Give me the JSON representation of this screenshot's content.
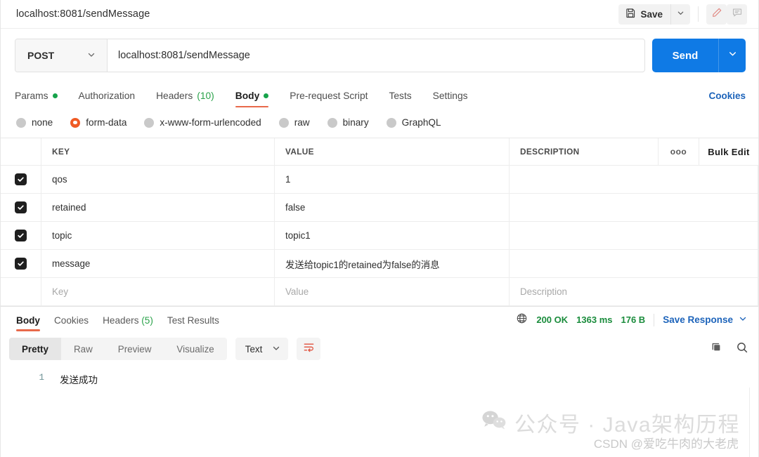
{
  "window": {
    "tab_title": "localhost:8081/sendMessage"
  },
  "toolbar": {
    "save_label": "Save",
    "save_icon": "floppy-disk-icon",
    "save_caret_icon": "chevron-down-icon",
    "edit_icon": "pencil-icon",
    "comment_icon": "comment-icon"
  },
  "request": {
    "method": "POST",
    "method_caret_icon": "chevron-down-icon",
    "url": "localhost:8081/sendMessage",
    "url_placeholder": "Enter request URL",
    "send_label": "Send",
    "send_caret_icon": "chevron-down-icon",
    "accent_blue": "#0f7ae5"
  },
  "request_tabs": {
    "items": [
      {
        "label": "Params",
        "dot": true,
        "count": "",
        "active": false
      },
      {
        "label": "Authorization",
        "dot": false,
        "count": "",
        "active": false
      },
      {
        "label": "Headers",
        "dot": false,
        "count": "(10)",
        "active": false
      },
      {
        "label": "Body",
        "dot": true,
        "count": "",
        "active": true
      },
      {
        "label": "Pre-request Script",
        "dot": false,
        "count": "",
        "active": false
      },
      {
        "label": "Tests",
        "dot": false,
        "count": "",
        "active": false
      },
      {
        "label": "Settings",
        "dot": false,
        "count": "",
        "active": false
      }
    ],
    "cookies_label": "Cookies",
    "active_underline_color": "#e8694a",
    "dot_color": "#16a34a"
  },
  "body_types": {
    "options": [
      {
        "label": "none",
        "selected": false
      },
      {
        "label": "form-data",
        "selected": true
      },
      {
        "label": "x-www-form-urlencoded",
        "selected": false
      },
      {
        "label": "raw",
        "selected": false
      },
      {
        "label": "binary",
        "selected": false
      },
      {
        "label": "GraphQL",
        "selected": false
      }
    ],
    "selected_color": "#ef5b25"
  },
  "kv_table": {
    "headers": {
      "key": "KEY",
      "value": "VALUE",
      "description": "DESCRIPTION",
      "more_icon": "ellipsis-icon",
      "more_glyph": "ooo",
      "bulk_edit": "Bulk Edit"
    },
    "rows": [
      {
        "checked": true,
        "key": "qos",
        "value": "1",
        "description": ""
      },
      {
        "checked": true,
        "key": "retained",
        "value": "false",
        "description": ""
      },
      {
        "checked": true,
        "key": "topic",
        "value": "topic1",
        "description": ""
      },
      {
        "checked": true,
        "key": "message",
        "value": "发送给topic1的retained为false的消息",
        "description": ""
      }
    ],
    "empty_row": {
      "key_placeholder": "Key",
      "value_placeholder": "Value",
      "description_placeholder": "Description"
    }
  },
  "response": {
    "tabs": [
      {
        "label": "Body",
        "count": "",
        "active": true
      },
      {
        "label": "Cookies",
        "count": "",
        "active": false
      },
      {
        "label": "Headers",
        "count": "(5)",
        "active": false
      },
      {
        "label": "Test Results",
        "count": "",
        "active": false
      }
    ],
    "globe_icon": "globe-icon",
    "status": "200 OK",
    "time": "1363 ms",
    "size": "176 B",
    "save_response": "Save Response",
    "save_response_caret_icon": "chevron-down-icon",
    "status_color": "#1a8c3c",
    "link_color": "#1c63ba"
  },
  "response_toolbar": {
    "views": [
      {
        "label": "Pretty",
        "active": true
      },
      {
        "label": "Raw",
        "active": false
      },
      {
        "label": "Preview",
        "active": false
      },
      {
        "label": "Visualize",
        "active": false
      }
    ],
    "format": "Text",
    "format_caret_icon": "chevron-down-icon",
    "wrap_icon": "wrap-lines-icon",
    "copy_icon": "copy-icon",
    "search_icon": "search-icon"
  },
  "response_body": {
    "lines": [
      {
        "number": "1",
        "text": "发送成功"
      }
    ]
  },
  "watermark": {
    "icon": "wechat-icon",
    "line1": "公众号 · Java架构历程",
    "line2": "CSDN @爱吃牛肉的大老虎"
  }
}
